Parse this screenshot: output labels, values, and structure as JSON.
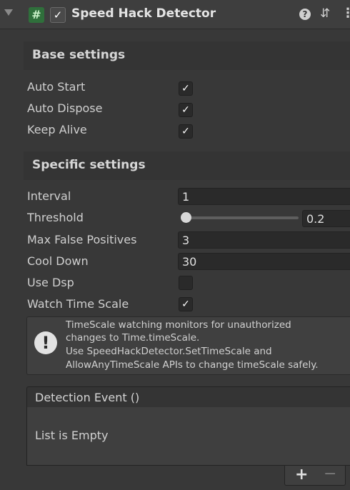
{
  "header": {
    "script_icon": "hash-script-icon",
    "script_glyph": "#",
    "enabled": true,
    "check_glyph": "✓",
    "title": "Speed Hack Detector",
    "help_glyph": "?",
    "presets_glyph": "⇵",
    "menu_glyph": "⋮"
  },
  "base_settings": {
    "title": "Base settings",
    "rows": [
      {
        "label": "Auto Start",
        "checked": true
      },
      {
        "label": "Auto Dispose",
        "checked": true
      },
      {
        "label": "Keep Alive",
        "checked": true
      }
    ]
  },
  "specific_settings": {
    "title": "Specific settings",
    "interval": {
      "label": "Interval",
      "value": "1"
    },
    "threshold": {
      "label": "Threshold",
      "value": "0.2",
      "slider_fraction": 0.0
    },
    "max_false_positives": {
      "label": "Max False Positives",
      "value": "3"
    },
    "cool_down": {
      "label": "Cool Down",
      "value": "30"
    },
    "use_dsp": {
      "label": "Use Dsp",
      "checked": false
    },
    "watch_time_scale": {
      "label": "Watch Time Scale",
      "checked": true
    }
  },
  "help_box": {
    "icon": "warning-exclamation-icon",
    "glyph": "!",
    "lines": [
      "TimeScale watching monitors for unauthorized",
      "changes to Time.timeScale.",
      "Use SpeedHackDetector.SetTimeScale and",
      "AllowAnyTimeScale APIs to change timeScale safely."
    ]
  },
  "event_list": {
    "title": "Detection Event ()",
    "empty_text": "List is Empty",
    "add_glyph": "+",
    "remove_glyph": "−"
  }
}
